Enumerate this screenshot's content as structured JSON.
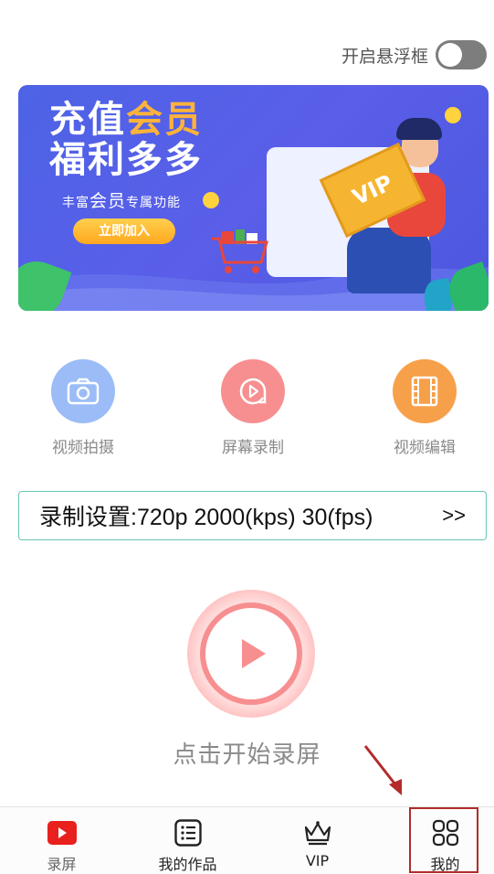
{
  "float_window": {
    "label": "开启悬浮框",
    "enabled": false
  },
  "banner": {
    "title_line1_a": "充值",
    "title_line1_b": "会员",
    "title_line2": "福利多多",
    "subtitle_a": "丰富",
    "subtitle_b": "会员",
    "subtitle_c": "专属功能",
    "button_label": "立即加入",
    "vip_text": "VIP"
  },
  "features": [
    {
      "label": "视频拍摄",
      "icon": "camera-icon",
      "color": "#9bbcf7"
    },
    {
      "label": "屏幕录制",
      "icon": "screen-record-icon",
      "color": "#f78f90"
    },
    {
      "label": "视频编辑",
      "icon": "film-icon",
      "color": "#f7a04a"
    }
  ],
  "settings": {
    "text": "录制设置:720p  2000(kps)  30(fps)",
    "arrow": ">>"
  },
  "record": {
    "caption": "点击开始录屏",
    "accent": "#f78f90"
  },
  "tabs": [
    {
      "label": "录屏",
      "icon": "record-tab-icon"
    },
    {
      "label": "我的作品",
      "icon": "list-icon"
    },
    {
      "label": "VIP",
      "icon": "crown-icon"
    },
    {
      "label": "我的",
      "icon": "grid-icon"
    }
  ],
  "colors": {
    "settings_border": "#68c6b3",
    "banner_bg": "#4d63e6",
    "highlight": "#b32b2b"
  }
}
